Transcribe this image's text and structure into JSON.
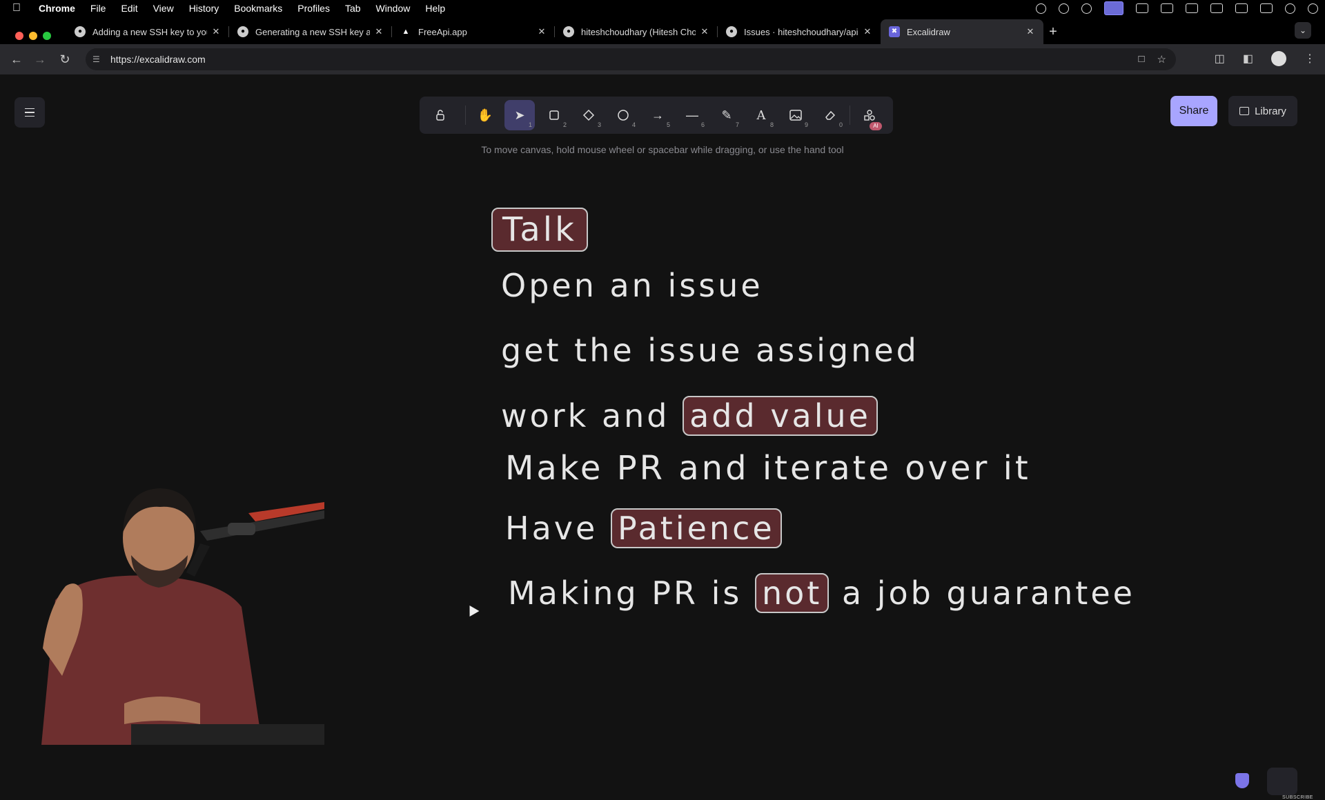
{
  "menubar": {
    "app": "Chrome",
    "items": [
      "File",
      "Edit",
      "View",
      "History",
      "Bookmarks",
      "Profiles",
      "Tab",
      "Window",
      "Help"
    ]
  },
  "tabs": [
    {
      "label": "Adding a new SSH key to you",
      "icon": "github-icon",
      "active": false
    },
    {
      "label": "Generating a new SSH key an",
      "icon": "github-icon",
      "active": false
    },
    {
      "label": "FreeApi.app",
      "icon": "freeapi-icon",
      "active": false
    },
    {
      "label": "hiteshchoudhary (Hitesh Cho",
      "icon": "github-icon",
      "active": false
    },
    {
      "label": "Issues · hiteshchoudhary/apih",
      "icon": "github-icon",
      "active": false
    },
    {
      "label": "Excalidraw",
      "icon": "excalidraw-icon",
      "active": true
    }
  ],
  "address": {
    "url": "https://excalidraw.com"
  },
  "toolbar": {
    "tools": [
      {
        "name": "hand-tool",
        "num": ""
      },
      {
        "name": "selection-tool",
        "num": "1",
        "active": true
      },
      {
        "name": "rectangle-tool",
        "num": "2"
      },
      {
        "name": "diamond-tool",
        "num": "3"
      },
      {
        "name": "ellipse-tool",
        "num": "4"
      },
      {
        "name": "arrow-tool",
        "num": "5"
      },
      {
        "name": "line-tool",
        "num": "6"
      },
      {
        "name": "pencil-tool",
        "num": "7"
      },
      {
        "name": "text-tool",
        "num": "8"
      },
      {
        "name": "image-tool",
        "num": "9"
      },
      {
        "name": "eraser-tool",
        "num": "0"
      }
    ],
    "ai_badge": "AI",
    "hint": "To move canvas, hold mouse wheel or spacebar while dragging, or use the hand tool"
  },
  "buttons": {
    "share": "Share",
    "library": "Library"
  },
  "drawing": {
    "talk": "Talk",
    "line1": "Open an issue",
    "line2": "get the issue assigned",
    "line3_pre": "work and",
    "line3_box": "add value",
    "line4": "Make PR and iterate over it",
    "line5_pre": "Have",
    "line5_box": "Patience",
    "line6_pre": "Making PR is",
    "line6_box": "not",
    "line6_post": "a job guarantee"
  },
  "overlay": {
    "subscribe": "SUBSCRIBE"
  },
  "colors": {
    "canvas_bg": "#121212",
    "box_fill": "#5a2a2e",
    "accent": "#a8a5ff",
    "active_tool": "#403e6a"
  }
}
